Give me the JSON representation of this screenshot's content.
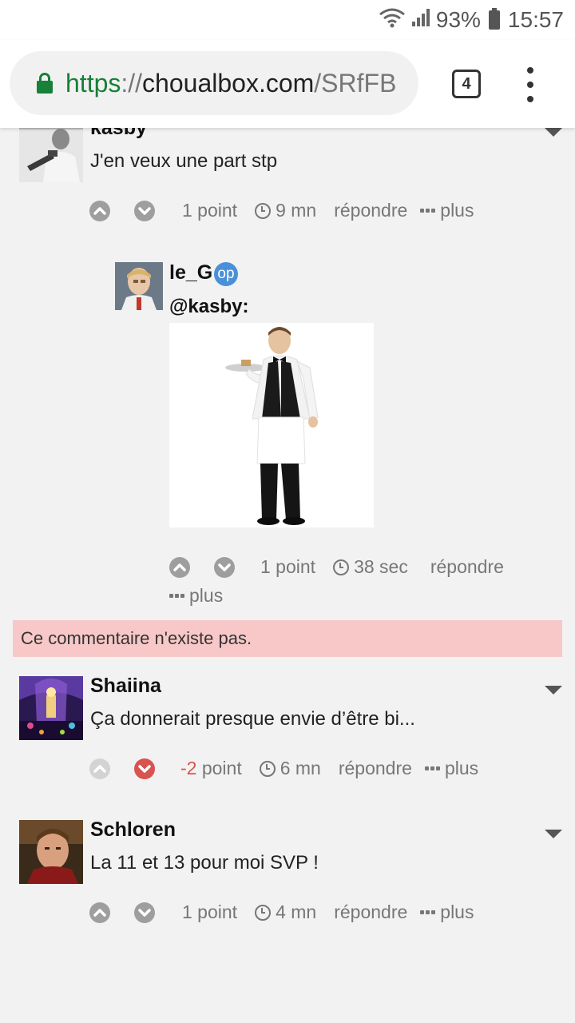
{
  "status_bar": {
    "battery": "93%",
    "time": "15:57"
  },
  "browser": {
    "url_scheme": "https",
    "url_sep": "://",
    "url_host": "choualbox.com",
    "url_path": "/SRfFB",
    "tab_count": "4"
  },
  "comments": [
    {
      "username": "kasby",
      "text": "J'en veux une part stp",
      "score": "1 point",
      "time": "9 mn",
      "reply_label": "répondre",
      "more_label": "plus"
    },
    {
      "username": "le_G",
      "badge": "op",
      "reply_to": "@kasby:",
      "score": "1 point",
      "time": "38 sec",
      "reply_label": "répondre",
      "more_label": "plus"
    },
    {
      "username": "Shaiina",
      "text": "Ça donnerait presque envie d’être bi...",
      "score_value": "-2",
      "score_unit": "point",
      "time": "6 mn",
      "reply_label": "répondre",
      "more_label": "plus"
    },
    {
      "username": "Schloren",
      "text": "La 11 et 13 pour moi SVP !",
      "score": "1 point",
      "time": "4 mn",
      "reply_label": "répondre",
      "more_label": "plus"
    }
  ],
  "deleted_notice": "Ce commentaire n'existe pas.",
  "colors": {
    "secure_green": "#188038",
    "downvote_red": "#d9534f",
    "alert_bg": "#f8c8c8",
    "op_blue": "#4a90d9"
  }
}
